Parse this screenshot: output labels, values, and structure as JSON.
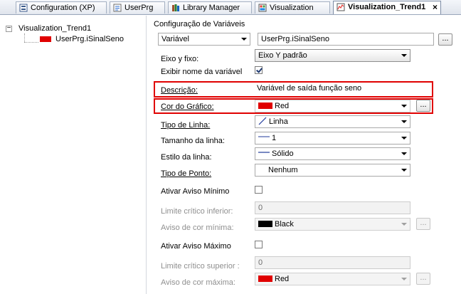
{
  "tabs": [
    {
      "label": "Configuration (XP)",
      "icon": "configuration-icon"
    },
    {
      "label": "UserPrg",
      "icon": "program-icon"
    },
    {
      "label": "Library Manager",
      "icon": "library-icon"
    },
    {
      "label": "Visualization",
      "icon": "visualization-icon"
    },
    {
      "label": "Visualization_Trend1",
      "icon": "trend-icon",
      "active": true,
      "close": "×"
    }
  ],
  "tree": {
    "root": "Visualization_Trend1",
    "expander": "−",
    "child": "UserPrg.iSinalSeno",
    "child_color": "#e00000"
  },
  "section_title": "Configuração de Variáveis",
  "variable": {
    "combo": "Variável",
    "value": "UserPrg.iSinalSeno",
    "button": "..."
  },
  "fields": {
    "eixo_label": "Eixo y fixo:",
    "eixo_value": "Eixo Y padrão",
    "exibir_label": "Exibir nome da variável",
    "descricao_label": "Descrição:",
    "descricao_value": "Variável de saída função seno",
    "cor_label": "Cor do Gráfico:",
    "cor_value": "Red",
    "cor_color": "#e00000",
    "cor_button": "...",
    "tipo_linha_label": "Tipo de Linha:",
    "tipo_linha_value": "Linha",
    "tamanho_label": "Tamanho da linha:",
    "tamanho_value": "1",
    "estilo_label": "Estilo da linha:",
    "estilo_value": "Sólido",
    "ponto_label": "Tipo de Ponto:",
    "ponto_value": "Nenhum"
  },
  "min_warning": {
    "label": "Ativar Aviso Mínimo",
    "limit_label": "Limite crítico inferior:",
    "limit_value": "0",
    "color_label": "Aviso de cor mínima:",
    "color_value": "Black",
    "color": "#000000",
    "button": "..."
  },
  "max_warning": {
    "label": "Ativar Aviso Máximo",
    "limit_label": "Limite crítico superior :",
    "limit_value": "0",
    "color_label": "Aviso de cor máxima:",
    "color_value": "Red",
    "color": "#e00000",
    "button": "..."
  },
  "highlight_color": "#e00000"
}
